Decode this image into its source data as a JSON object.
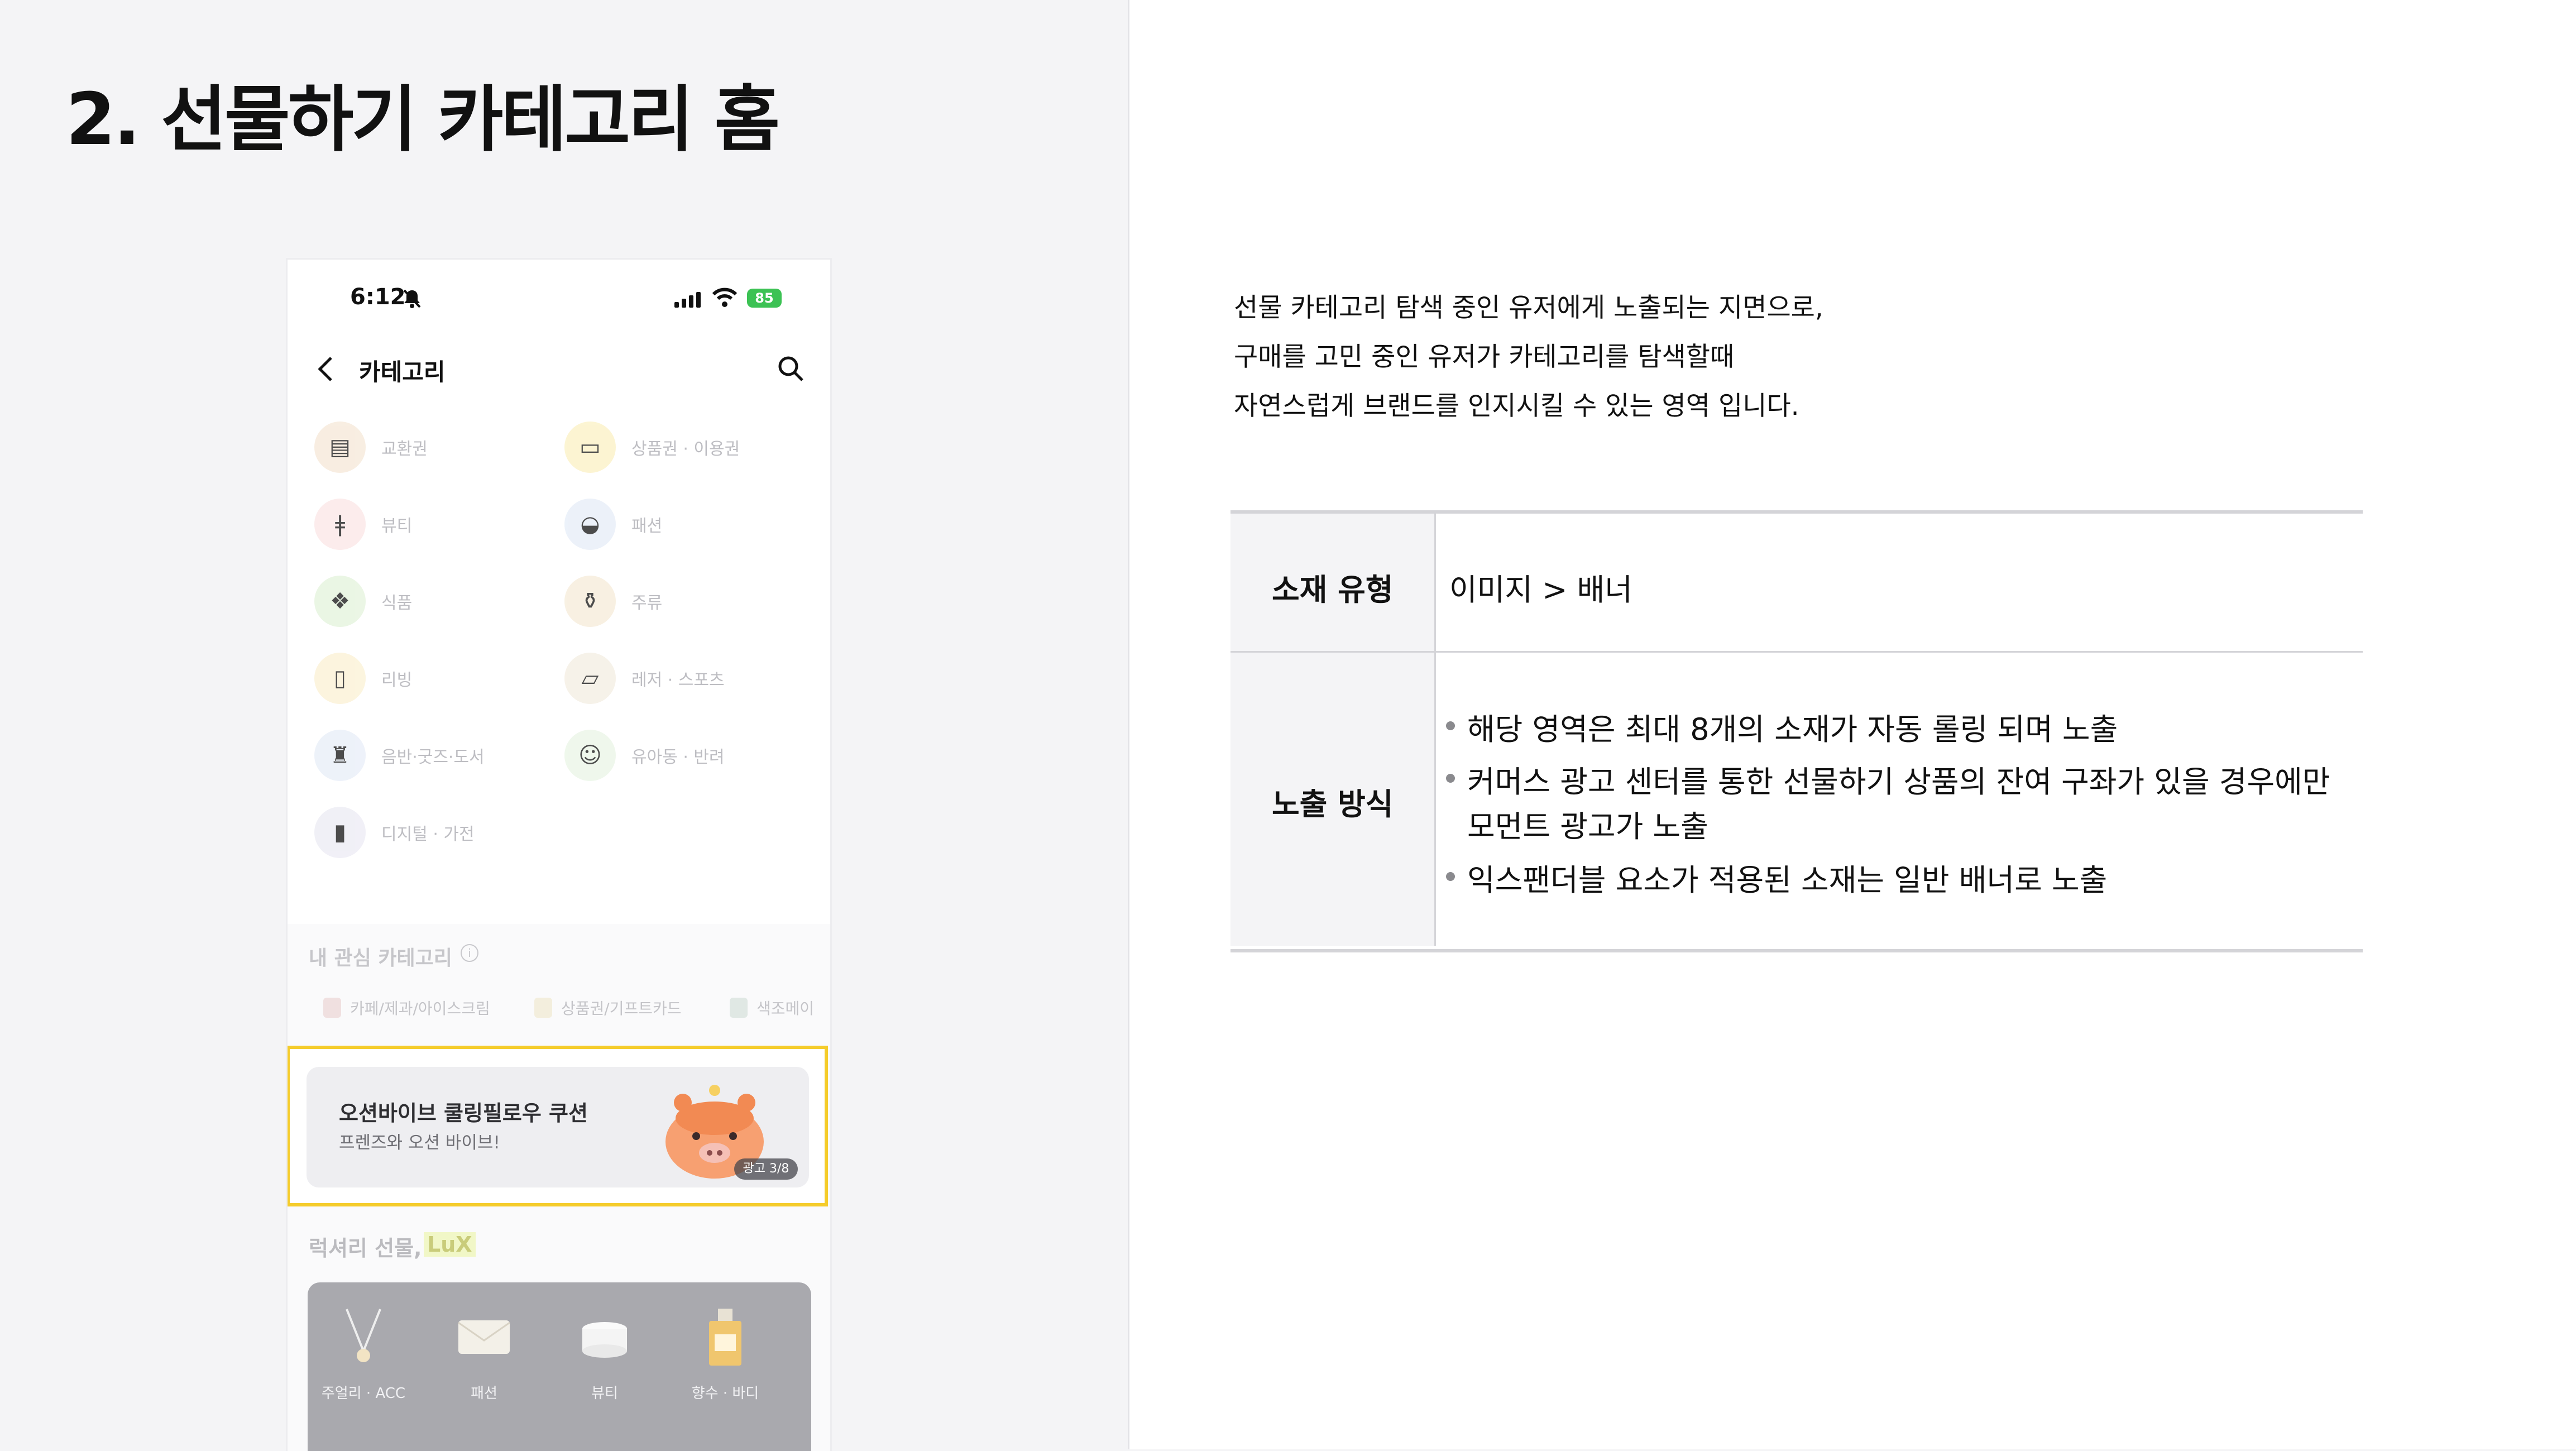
{
  "page": {
    "title": "2. 선물하기 카테고리 홈"
  },
  "phone": {
    "status_time": "6:12",
    "battery": "85",
    "header_title": "카테고리",
    "categories": [
      {
        "label": "교환권",
        "icon": "coupon-icon",
        "color": "#f6e8d8"
      },
      {
        "label": "상품권 · 이용권",
        "icon": "voucher-icon",
        "color": "#fbf1c4"
      },
      {
        "label": "뷰티",
        "icon": "beauty-icon",
        "color": "#fbe6e6"
      },
      {
        "label": "패션",
        "icon": "fashion-cap-icon",
        "color": "#e6edf8"
      },
      {
        "label": "식품",
        "icon": "food-icon",
        "color": "#e4f3dc"
      },
      {
        "label": "주류",
        "icon": "liquor-icon",
        "color": "#f6ecd9"
      },
      {
        "label": "리빙",
        "icon": "living-icon",
        "color": "#fbf1d4"
      },
      {
        "label": "레저 · 스포츠",
        "icon": "sneaker-icon",
        "color": "#f4eee2"
      },
      {
        "label": "음반·굿즈·도서",
        "icon": "goods-icon",
        "color": "#e8eef8"
      },
      {
        "label": "유아동 · 반려",
        "icon": "kids-pet-icon",
        "color": "#eaf5e6"
      },
      {
        "label": "디지털 · 가전",
        "icon": "digital-icon",
        "color": "#ecebf4"
      }
    ],
    "interest_title": "내 관심 카테고리",
    "interest_chips": [
      {
        "label": "카페/제과/아이스크림"
      },
      {
        "label": "상품권/기프트카드"
      },
      {
        "label": "색조메이"
      }
    ],
    "banner": {
      "title": "오션바이브 쿨링필로우 쿠션",
      "subtitle": "프렌즈와 오션 바이브!",
      "badge": "광고 3/8",
      "highlight_color": "#f5cc2b"
    },
    "lux_title": "럭셔리 선물,",
    "lux_tag": "LuX",
    "lux_items": [
      {
        "label": "주얼리 · ACC"
      },
      {
        "label": "패션"
      },
      {
        "label": "뷰티"
      },
      {
        "label": "향수 · 바디"
      }
    ]
  },
  "description": {
    "lines": [
      "선물 카테고리 탐색 중인 유저에게 노출되는 지면으로,",
      "구매를 고민 중인 유저가 카테고리를 탐색할때",
      "자연스럽게 브랜드를 인지시킬 수 있는 영역 입니다."
    ]
  },
  "table": {
    "type_label": "소재 유형",
    "type_value": "이미지 > 배너",
    "method_label": "노출 방식",
    "bullets": [
      "해당 영역은 최대 8개의 소재가 자동 롤링 되며 노출",
      "커머스 광고 센터를 통한 선물하기 상품의 잔여 구좌가 있을 경우에만",
      "모먼트 광고가 노출",
      "익스팬더블 요소가 적용된 소재는 일반 배너로 노출"
    ]
  }
}
